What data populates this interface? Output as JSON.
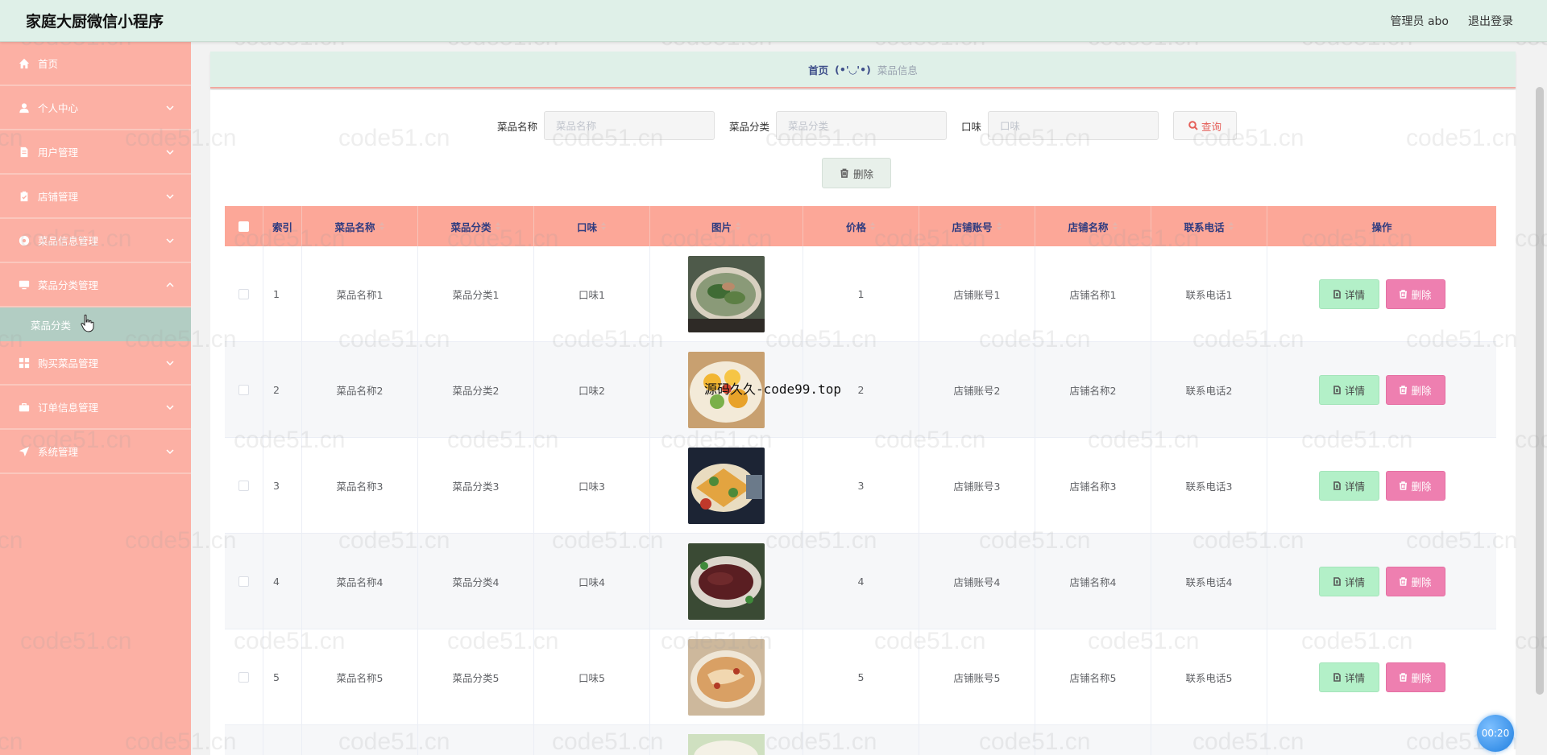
{
  "header": {
    "title": "家庭大厨微信小程序",
    "user": "管理员 abo",
    "logout": "退出登录"
  },
  "sidebar": {
    "items": [
      {
        "label": "首页",
        "icon": "home-icon"
      },
      {
        "label": "个人中心",
        "icon": "user-icon"
      },
      {
        "label": "用户管理",
        "icon": "document-icon"
      },
      {
        "label": "店铺管理",
        "icon": "clipboard-icon"
      },
      {
        "label": "菜品信息管理",
        "icon": "compass-icon"
      },
      {
        "label": "菜品分类管理",
        "icon": "monitor-icon",
        "expanded": true
      },
      {
        "label": "购买菜品管理",
        "icon": "grid-icon"
      },
      {
        "label": "订单信息管理",
        "icon": "briefcase-icon"
      },
      {
        "label": "系统管理",
        "icon": "send-icon"
      }
    ],
    "submenu": {
      "label": "菜品分类"
    }
  },
  "breadcrumb": {
    "home": "首页",
    "separator": "(•'◡'•)",
    "current": "菜品信息"
  },
  "search": {
    "name_label": "菜品名称",
    "name_placeholder": "菜品名称",
    "category_label": "菜品分类",
    "category_placeholder": "菜品分类",
    "taste_label": "口味",
    "taste_placeholder": "口味",
    "query_button": "查询"
  },
  "toolbar": {
    "delete_button": "删除"
  },
  "table": {
    "columns": [
      "索引",
      "菜品名称",
      "菜品分类",
      "口味",
      "图片",
      "价格",
      "店铺账号",
      "店铺名称",
      "联系电话",
      "操作"
    ],
    "rows": [
      {
        "index": "1",
        "name": "菜品名称1",
        "category": "菜品分类1",
        "taste": "口味1",
        "price": "1",
        "account": "店铺账号1",
        "shop": "店铺名称1",
        "phone": "联系电话1"
      },
      {
        "index": "2",
        "name": "菜品名称2",
        "category": "菜品分类2",
        "taste": "口味2",
        "price": "2",
        "account": "店铺账号2",
        "shop": "店铺名称2",
        "phone": "联系电话2"
      },
      {
        "index": "3",
        "name": "菜品名称3",
        "category": "菜品分类3",
        "taste": "口味3",
        "price": "3",
        "account": "店铺账号3",
        "shop": "店铺名称3",
        "phone": "联系电话3"
      },
      {
        "index": "4",
        "name": "菜品名称4",
        "category": "菜品分类4",
        "taste": "口味4",
        "price": "4",
        "account": "店铺账号4",
        "shop": "店铺名称4",
        "phone": "联系电话4"
      },
      {
        "index": "5",
        "name": "菜品名称5",
        "category": "菜品分类5",
        "taste": "口味5",
        "price": "5",
        "account": "店铺账号5",
        "shop": "店铺名称5",
        "phone": "联系电话5"
      }
    ],
    "detail_button": "详情",
    "delete_button": "删除"
  },
  "overlay_text": "源码久久-code99.top",
  "watermark": "code51.cn",
  "timer": "00:20",
  "colors": {
    "header_bg": "#dff0e8",
    "sidebar_bg": "#fcb0a4",
    "submenu_bg": "#b2cdc3",
    "table_head_bg": "#fca798",
    "detail_btn": "#b3f0c8",
    "delete_btn": "#ee7fb0",
    "accent_text": "#2f3c80"
  }
}
